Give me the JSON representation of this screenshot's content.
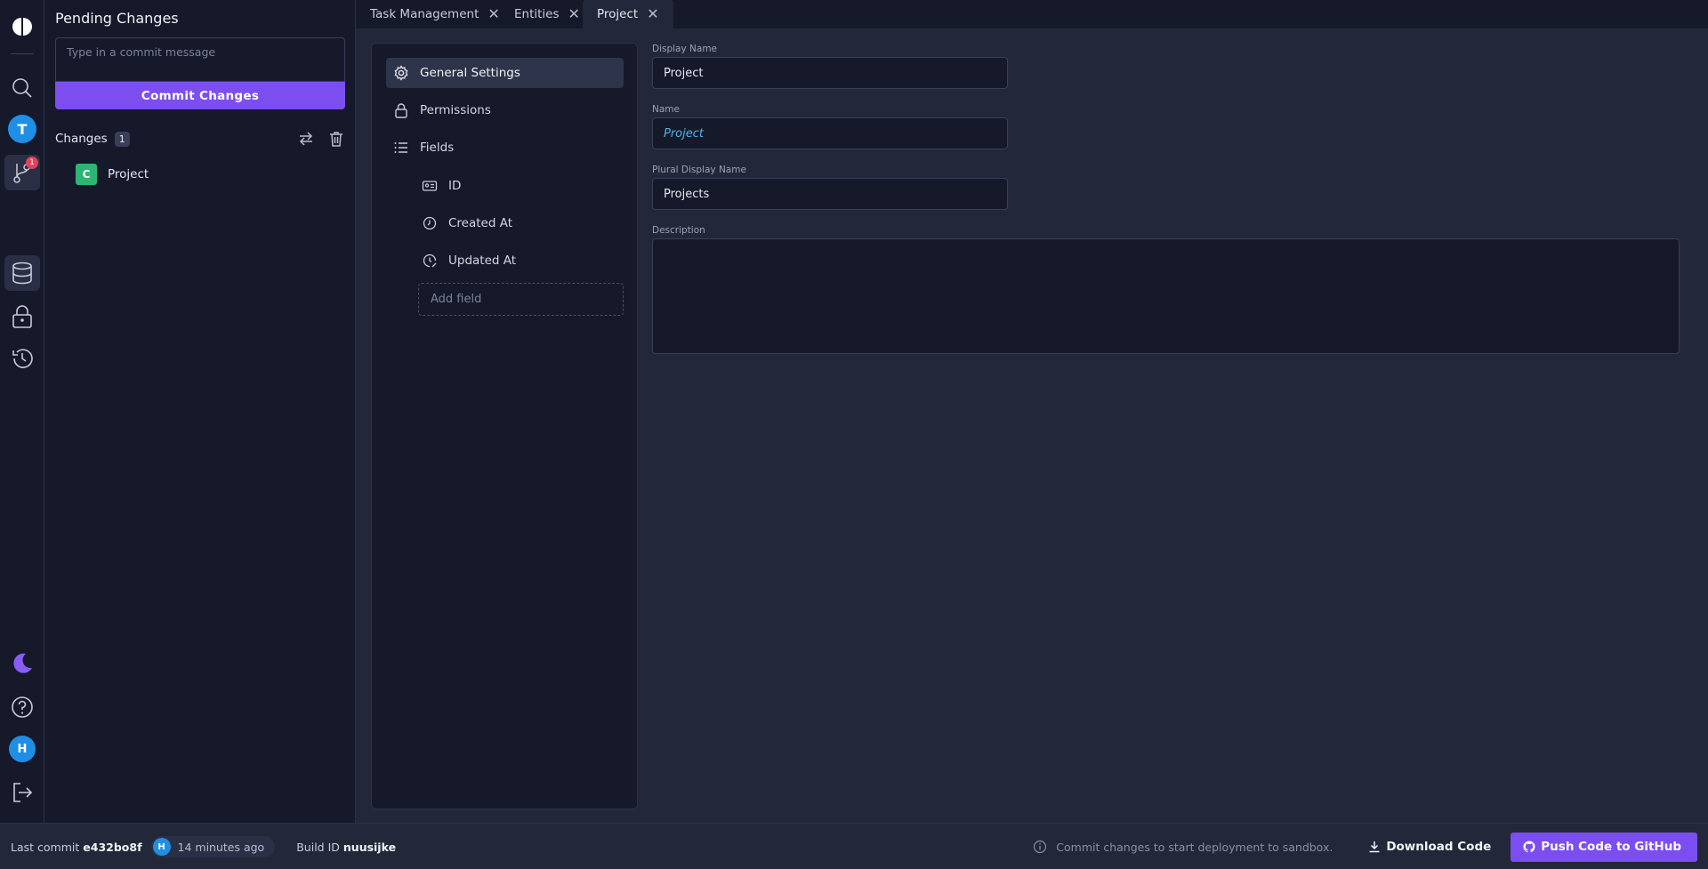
{
  "rail": {
    "user_initial": "T",
    "git_badge": "1",
    "profile_initial": "H"
  },
  "pending": {
    "title": "Pending Changes",
    "commit_placeholder": "Type in a commit message",
    "commit_button": "Commit Changes",
    "changes_label": "Changes",
    "changes_count": "1",
    "items": [
      {
        "tag": "C",
        "name": "Project"
      }
    ]
  },
  "tabs": [
    {
      "label": "Task Management"
    },
    {
      "label": "Entities"
    },
    {
      "label": "Project"
    }
  ],
  "nav": {
    "general": "General Settings",
    "permissions": "Permissions",
    "fields": "Fields",
    "field_items": [
      {
        "label": "ID"
      },
      {
        "label": "Created At"
      },
      {
        "label": "Updated At"
      }
    ],
    "add_field": "Add field"
  },
  "form": {
    "display_name_label": "Display Name",
    "display_name_value": "Project",
    "name_label": "Name",
    "name_value": "Project",
    "plural_label": "Plural Display Name",
    "plural_value": "Projects",
    "description_label": "Description",
    "description_value": ""
  },
  "bottom": {
    "last_commit_label": "Last commit",
    "commit_hash": "e432bo8f",
    "author_initial": "H",
    "time_ago": "14 minutes ago",
    "build_label": "Build ID",
    "build_id": "nuusijke",
    "hint": "Commit changes to start deployment to sandbox.",
    "download": "Download Code",
    "push": "Push Code to GitHub"
  },
  "colors": {
    "accent": "#7c4ef0",
    "created_tag": "#2bb673",
    "avatar": "#1f8fe6",
    "badge": "#e2425a"
  }
}
